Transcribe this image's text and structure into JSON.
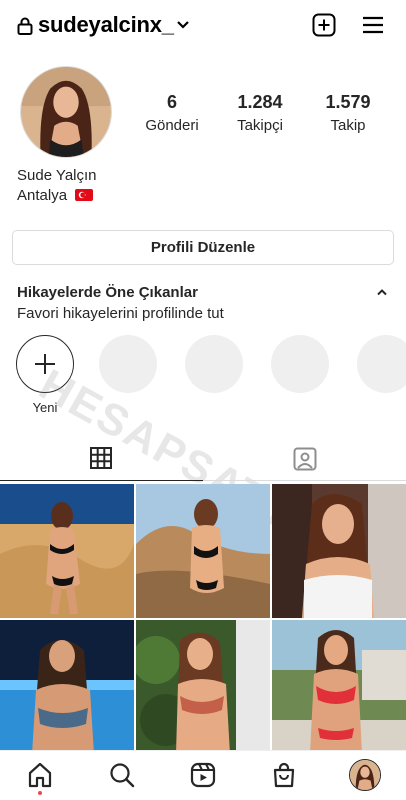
{
  "header": {
    "username": "sudeyalcinx_",
    "icons": [
      "lock-icon",
      "chevron-down-icon",
      "new-post-icon",
      "menu-icon"
    ]
  },
  "profile": {
    "full_name": "Sude Yalçın",
    "location": "Antalya",
    "stats": [
      {
        "value": "6",
        "label": "Gönderi"
      },
      {
        "value": "1.284",
        "label": "Takipçi"
      },
      {
        "value": "1.579",
        "label": "Takip"
      }
    ],
    "edit_button": "Profili Düzenle"
  },
  "highlights": {
    "title": "Hikayelerde Öne Çıkanlar",
    "subtitle": "Favori hikayelerini profilinde tut",
    "new_label": "Yeni"
  },
  "watermark": "HESAPSAT.NET",
  "tabs": [
    {
      "icon": "grid-icon",
      "active": true
    },
    {
      "icon": "tagged-icon",
      "active": false
    }
  ],
  "posts": [
    {
      "name": "post-1",
      "scene": "beach-dunes"
    },
    {
      "name": "post-2",
      "scene": "cliff-sunset"
    },
    {
      "name": "post-3",
      "scene": "white-top"
    },
    {
      "name": "post-4",
      "scene": "pool-night"
    },
    {
      "name": "post-5",
      "scene": "plants"
    },
    {
      "name": "post-6",
      "scene": "resort"
    }
  ],
  "bottom_nav": [
    "home-icon",
    "search-icon",
    "reels-icon",
    "shop-icon",
    "profile-avatar"
  ],
  "colors": {
    "text": "#262626",
    "border": "#dbdbdb",
    "notification": "#ed4956",
    "flag": "#e30a17"
  }
}
